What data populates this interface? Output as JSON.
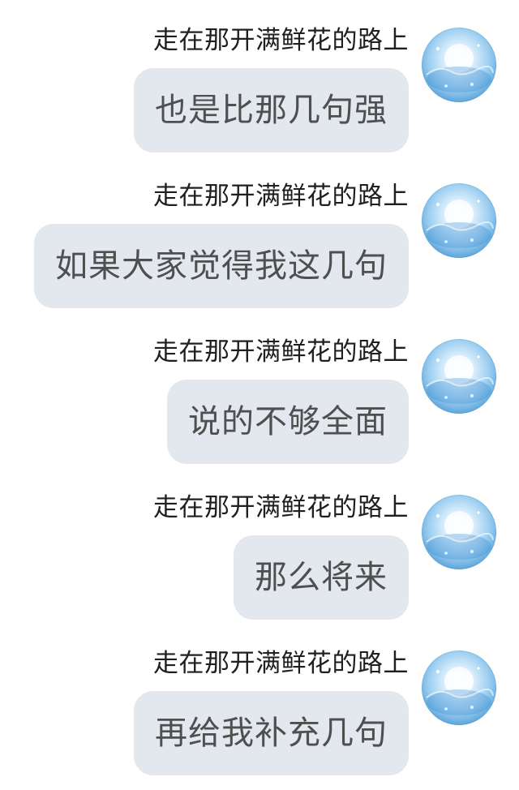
{
  "messages": [
    {
      "sender": "走在那开满鲜花的路上",
      "text": "也是比那几句强"
    },
    {
      "sender": "走在那开满鲜花的路上",
      "text": "如果大家觉得我这几句"
    },
    {
      "sender": "走在那开满鲜花的路上",
      "text": "说的不够全面"
    },
    {
      "sender": "走在那开满鲜花的路上",
      "text": "那么将来"
    },
    {
      "sender": "走在那开满鲜花的路上",
      "text": "再给我补充几句"
    }
  ],
  "avatar": {
    "icon": "avatar-sky-image",
    "colors": [
      "#f7fbff",
      "#9fd0f1",
      "#2f78c2"
    ]
  },
  "bubble_color": "#e3e8ef"
}
